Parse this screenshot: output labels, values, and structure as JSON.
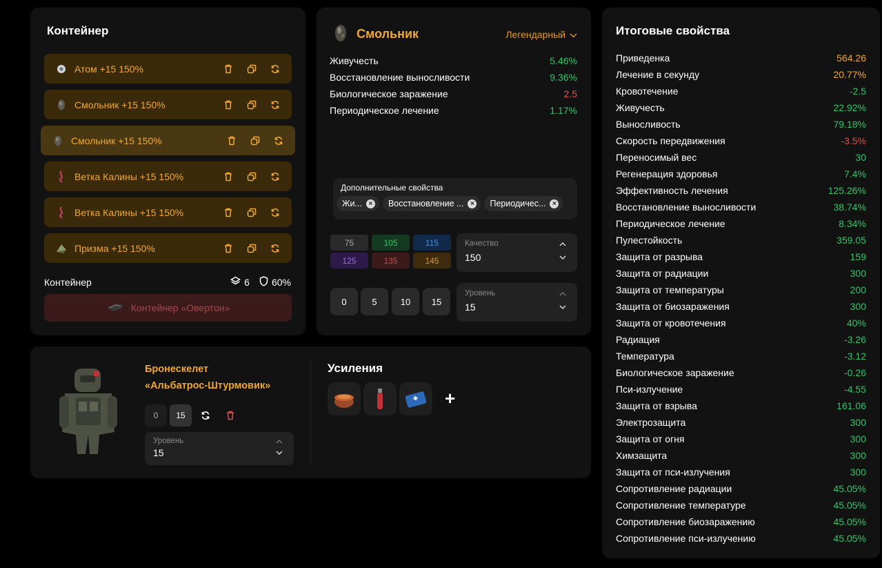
{
  "container": {
    "title": "Контейнер",
    "artifacts": [
      {
        "label": "Атом  +15  150%",
        "icon": "atom-icon"
      },
      {
        "label": "Смольник  +15  150%",
        "icon": "smolnik-icon"
      },
      {
        "label": "Смольник  +15  150%",
        "icon": "smolnik-icon"
      },
      {
        "label": "Ветка Калины  +15  150%",
        "icon": "kalina-icon"
      },
      {
        "label": "Ветка Калины  +15  150%",
        "icon": "kalina-icon"
      },
      {
        "label": "Призма  +15  150%",
        "icon": "prism-icon"
      }
    ],
    "footer_label": "Контейнер",
    "slots": "6",
    "protection": "60%",
    "container_button": "Контейнер «Овертон»"
  },
  "artifact": {
    "name": "Смольник",
    "rarity": "Легендарный",
    "properties": [
      {
        "name": "Живучесть",
        "value": "5.46%",
        "color": "#35c36b"
      },
      {
        "name": "Восстановление выносливости",
        "value": "9.36%",
        "color": "#35c36b"
      },
      {
        "name": "Биологическое заражение",
        "value": "2.5",
        "color": "#d9534f"
      },
      {
        "name": "Периодическое лечение",
        "value": "1.17%",
        "color": "#35c36b"
      }
    ],
    "extra_title": "Дополнительные свойства",
    "extra_chips": [
      "Жи...",
      "Восстановление ...",
      "Периодичес..."
    ],
    "quality_presets": [
      {
        "value": "75",
        "bg": "#2a2a2a",
        "fg": "#aaaaaa"
      },
      {
        "value": "105",
        "bg": "#143a22",
        "fg": "#37c26c"
      },
      {
        "value": "115",
        "bg": "#112a4a",
        "fg": "#4a8fe0"
      },
      {
        "value": "125",
        "bg": "#2e1a48",
        "fg": "#a06ae0"
      },
      {
        "value": "135",
        "bg": "#3a1a1a",
        "fg": "#c05050"
      },
      {
        "value": "145",
        "bg": "#3e2a0c",
        "fg": "#e09a2e"
      }
    ],
    "quality_caption": "Качество",
    "quality_value": "150",
    "level_presets": [
      "0",
      "5",
      "10",
      "15"
    ],
    "level_caption": "Уровень",
    "level_value": "15"
  },
  "armor": {
    "name_line1": "Бронескелет",
    "name_line2": "«Альбатрос-Штурмовик»",
    "level_presets": [
      "0",
      "15"
    ],
    "level_caption": "Уровень",
    "level_value": "15",
    "boosts_title": "Усиления",
    "boosts": [
      "stew-icon",
      "injector-icon",
      "medkit-icon"
    ],
    "add_label": "+"
  },
  "totals": {
    "title": "Итоговые свойства",
    "rows": [
      {
        "name": "Приведенка",
        "value": "564.26",
        "color": "#f0a832"
      },
      {
        "name": "Лечение в секунду",
        "value": "20.77%",
        "color": "#f0a832"
      },
      {
        "name": "Кровотечение",
        "value": "-2.5",
        "color": "#35c36b"
      },
      {
        "name": "Живучесть",
        "value": "22.92%",
        "color": "#35c36b"
      },
      {
        "name": "Выносливость",
        "value": "79.18%",
        "color": "#35c36b"
      },
      {
        "name": "Скорость передвижения",
        "value": "-3.5%",
        "color": "#d9534f"
      },
      {
        "name": "Переносимый вес",
        "value": "30",
        "color": "#35c36b"
      },
      {
        "name": "Регенерация здоровья",
        "value": "7.4%",
        "color": "#35c36b"
      },
      {
        "name": "Эффективность лечения",
        "value": "125.26%",
        "color": "#35c36b"
      },
      {
        "name": "Восстановление выносливости",
        "value": "38.74%",
        "color": "#35c36b"
      },
      {
        "name": "Периодическое лечение",
        "value": "8.34%",
        "color": "#35c36b"
      },
      {
        "name": "Пулестойкость",
        "value": "359.05",
        "color": "#35c36b"
      },
      {
        "name": "Защита от разрыва",
        "value": "159",
        "color": "#35c36b"
      },
      {
        "name": "Защита от радиации",
        "value": "300",
        "color": "#35c36b"
      },
      {
        "name": "Защита от температуры",
        "value": "200",
        "color": "#35c36b"
      },
      {
        "name": "Защита от биозаражения",
        "value": "300",
        "color": "#35c36b"
      },
      {
        "name": "Защита от кровотечения",
        "value": "40%",
        "color": "#35c36b"
      },
      {
        "name": "Радиация",
        "value": "-3.26",
        "color": "#35c36b"
      },
      {
        "name": "Температура",
        "value": "-3.12",
        "color": "#35c36b"
      },
      {
        "name": "Биологическое заражение",
        "value": "-0.26",
        "color": "#35c36b"
      },
      {
        "name": "Пси-излучение",
        "value": "-4.55",
        "color": "#35c36b"
      },
      {
        "name": "Защита от взрыва",
        "value": "161.06",
        "color": "#35c36b"
      },
      {
        "name": "Электрозащита",
        "value": "300",
        "color": "#35c36b"
      },
      {
        "name": "Защита от огня",
        "value": "300",
        "color": "#35c36b"
      },
      {
        "name": "Химзащита",
        "value": "300",
        "color": "#35c36b"
      },
      {
        "name": "Защита от пси-излучения",
        "value": "300",
        "color": "#35c36b"
      },
      {
        "name": "Сопротивление радиации",
        "value": "45.05%",
        "color": "#35c36b"
      },
      {
        "name": "Сопротивление температуре",
        "value": "45.05%",
        "color": "#35c36b"
      },
      {
        "name": "Сопротивление биозаражению",
        "value": "45.05%",
        "color": "#35c36b"
      },
      {
        "name": "Сопротивление пси-излучению",
        "value": "45.05%",
        "color": "#35c36b"
      }
    ]
  }
}
